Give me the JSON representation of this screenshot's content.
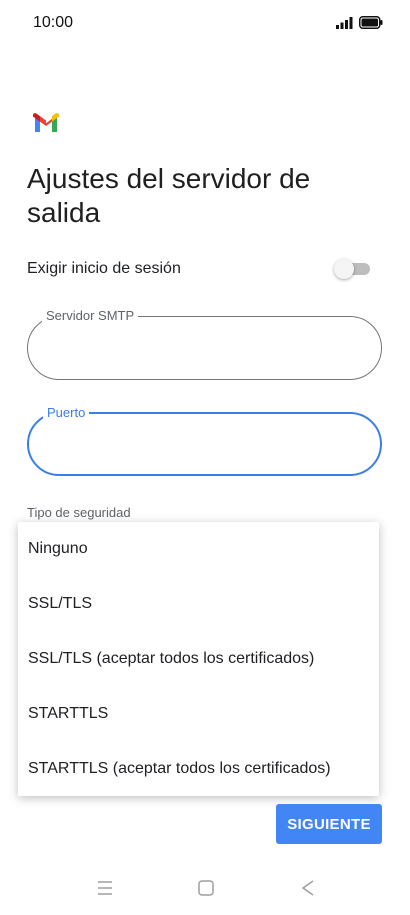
{
  "status_bar": {
    "time": "10:00",
    "signal_icon": "signal-icon",
    "battery_icon": "battery-icon"
  },
  "app": {
    "logo_icon": "gmail-logo-icon"
  },
  "page": {
    "title": "Ajustes del servidor de salida"
  },
  "signin": {
    "label": "Exigir inicio de sesión",
    "toggle_on": false
  },
  "smtp_field": {
    "label": "Servidor SMTP",
    "value": ""
  },
  "port_field": {
    "label": "Puerto",
    "value": "",
    "focused": true
  },
  "security": {
    "label": "Tipo de seguridad",
    "options": [
      "Ninguno",
      "SSL/TLS",
      "SSL/TLS (aceptar todos los certificados)",
      "STARTTLS",
      "STARTTLS (aceptar todos los certificados)"
    ]
  },
  "buttons": {
    "next": "SIGUIENTE"
  },
  "nav": {
    "menu_icon": "recent-apps-icon",
    "home_icon": "home-icon",
    "back_icon": "back-icon"
  },
  "colors": {
    "accent": "#4285f4",
    "focus": "#3a7ee6"
  }
}
